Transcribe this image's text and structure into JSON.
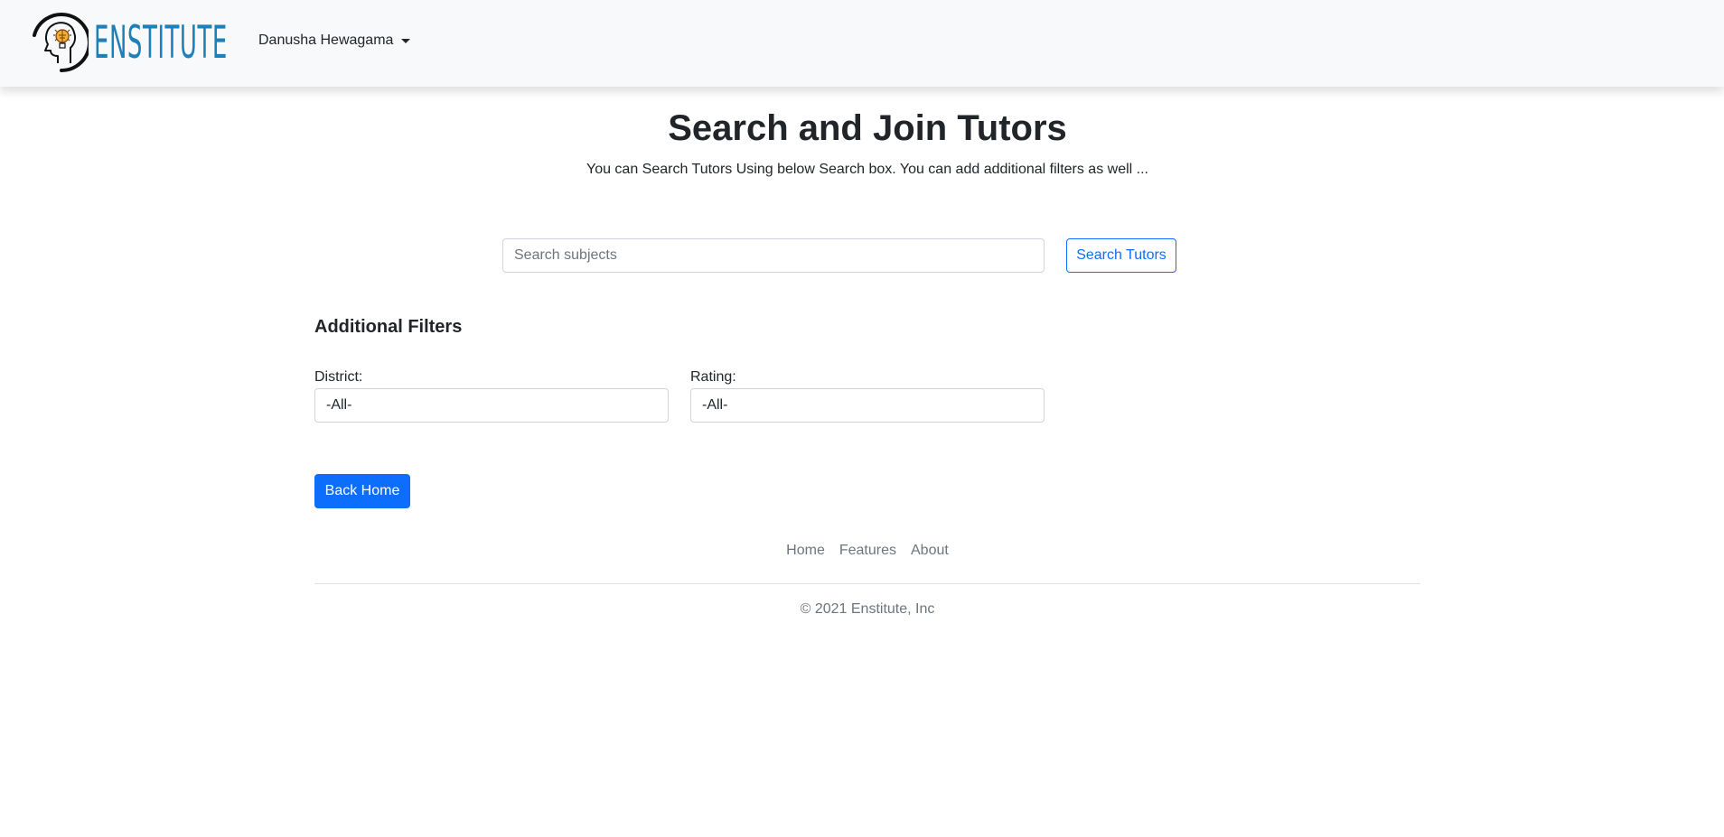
{
  "navbar": {
    "brand": {
      "icon": "brain-lightbulb-logo-icon",
      "wordmark": "ENSTITUTE",
      "wordmark_color": "#1f7fb8"
    },
    "user_menu": {
      "label": "Danusha Hewagama",
      "icon": "caret-down-icon"
    }
  },
  "header": {
    "title": "Search and Join Tutors",
    "subtitle": "You can Search Tutors Using below Search box. You can add additional filters as well ..."
  },
  "search": {
    "placeholder": "Search subjects",
    "value": "",
    "button_label": "Search Tutors"
  },
  "filters": {
    "heading": "Additional Filters",
    "district": {
      "label": "District:",
      "selected": "-All-"
    },
    "rating": {
      "label": "Rating:",
      "selected": "-All-"
    }
  },
  "actions": {
    "back_label": "Back Home"
  },
  "footer": {
    "links": [
      "Home",
      "Features",
      "About"
    ],
    "copyright": "© 2021 Enstitute, Inc"
  },
  "colors": {
    "primary": "#0d6efd",
    "muted": "#6c757d",
    "navbar_bg": "#f8f9fa"
  }
}
